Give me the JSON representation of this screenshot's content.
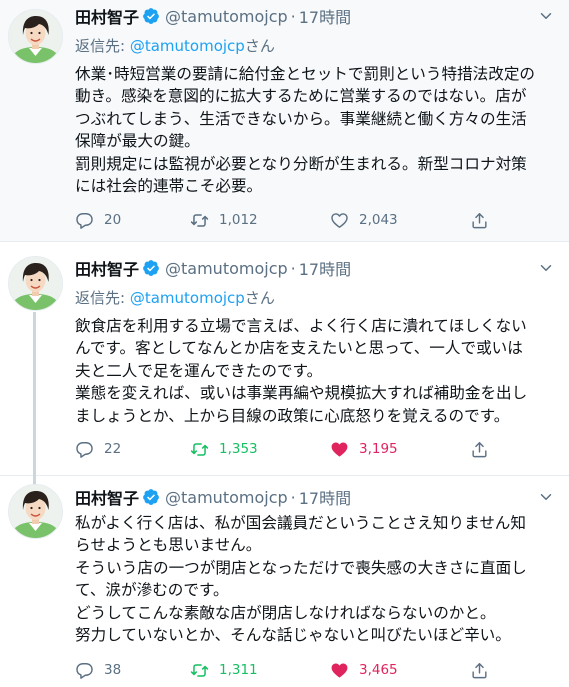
{
  "tweets": [
    {
      "name": "田村智子",
      "handle": "@tamutomojcp",
      "separator": "·",
      "time": "17時間",
      "reply_prefix": "返信先: ",
      "reply_handle": "@tamutomojcp",
      "reply_suffix": "さん",
      "lines": [
        "休業･時短営業の要請に給付金とセットで罰則という特措法改定の",
        "動き。感染を意図的に拡大するために営業するのではない。店が",
        "つぶれてしまう、生活できないから。事業継続と働く方々の生活",
        "保障が最大の鍵。",
        "罰則規定には監視が必要となり分断が生まれる。新型コロナ対策",
        "には社会的連帯こそ必要。"
      ],
      "reply_count": "20",
      "retweet_count": "1,012",
      "like_count": "2,043",
      "retweeted": false,
      "liked": false
    },
    {
      "name": "田村智子",
      "handle": "@tamutomojcp",
      "separator": "·",
      "time": "17時間",
      "reply_prefix": "返信先: ",
      "reply_handle": "@tamutomojcp",
      "reply_suffix": "さん",
      "lines": [
        "飲食店を利用する立場で言えば、よく行く店に潰れてほしくない",
        "んです。客としてなんとか店を支えたいと思って、一人で或いは",
        "夫と二人で足を運んできたのです。",
        "業態を変えれば、或いは事業再編や規模拡大すれば補助金を出し",
        "ましょうとか、上から目線の政策に心底怒りを覚えるのです。"
      ],
      "reply_count": "22",
      "retweet_count": "1,353",
      "like_count": "3,195",
      "retweeted": true,
      "liked": true
    },
    {
      "name": "田村智子",
      "handle": "@tamutomojcp",
      "separator": "·",
      "time": "17時間",
      "lines": [
        "私がよく行く店は、私が国会議員だということさえ知りません知",
        "らせようとも思いません。",
        "そういう店の一つが閉店となっただけで喪失感の大きさに直面し",
        "て、涙が滲むのです。",
        "どうしてこんな素敵な店が閉店しなければならないのかと。",
        "努力していないとか、そんな話じゃないと叫びたいほど辛い。"
      ],
      "reply_count": "38",
      "retweet_count": "1,311",
      "like_count": "3,465",
      "retweeted": true,
      "liked": true
    }
  ],
  "colors": {
    "accent": "#1da1f2",
    "muted": "#5b7083",
    "retweet_active": "#17bf63",
    "like_active": "#e0245e"
  },
  "icons": [
    "verified-badge-icon",
    "chevron-down-icon",
    "reply-icon",
    "retweet-icon",
    "like-icon",
    "share-icon"
  ]
}
